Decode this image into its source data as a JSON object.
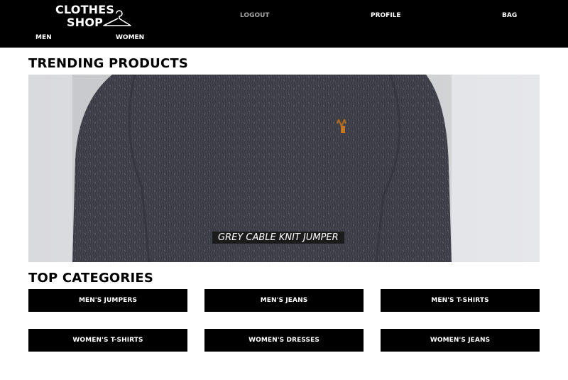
{
  "header": {
    "logo": {
      "line1": "CLOTHES",
      "line2": "SHOP",
      "icon": "hanger-icon"
    },
    "nav": {
      "logout": "LOGOUT",
      "profile": "PROFILE",
      "bag": "BAG"
    },
    "subnav": {
      "men": "MEN",
      "women": "WOMEN"
    }
  },
  "trending": {
    "title": "TRENDING PRODUCTS",
    "product": {
      "caption": "GREY CABLE KNIT JUMPER"
    }
  },
  "categories": {
    "title": "TOP CATEGORIES",
    "items": [
      "MEN'S JUMPERS",
      "MEN'S JEANS",
      "MEN'S T-SHIRTS",
      "WOMEN'S T-SHIRTS",
      "WOMEN'S DRESSES",
      "WOMEN'S JEANS"
    ]
  },
  "colors": {
    "header_bg": "#000000",
    "muted_link": "#a6a6a6",
    "button_bg": "#000000",
    "button_text": "#ffffff"
  }
}
